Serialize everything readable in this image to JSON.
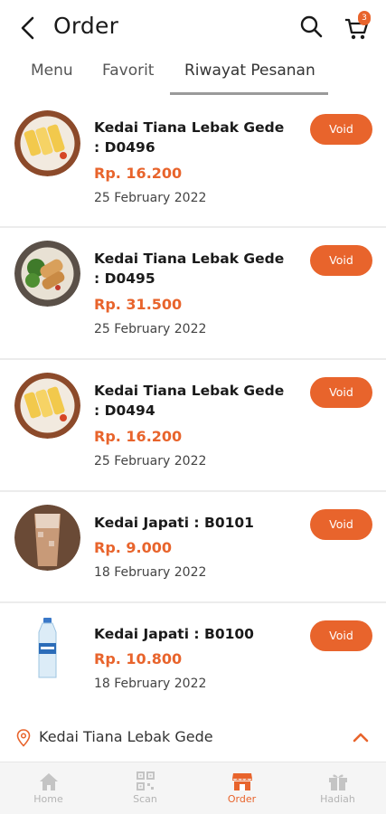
{
  "header": {
    "title": "Order",
    "cart_count": "3"
  },
  "tabs": [
    {
      "label": "Menu",
      "active": false
    },
    {
      "label": "Favorit",
      "active": false
    },
    {
      "label": "Riwayat Pesanan",
      "active": true
    }
  ],
  "orders": [
    {
      "name": "Kedai Tiana Lebak Gede : D0496",
      "price": "Rp. 16.200",
      "date": "25 February 2022",
      "action": "Void",
      "image": "omelette-roll"
    },
    {
      "name": "Kedai Tiana Lebak Gede : D0495",
      "price": "Rp. 31.500",
      "date": "25 February 2022",
      "action": "Void",
      "image": "wrap-with-salad"
    },
    {
      "name": "Kedai Tiana Lebak Gede : D0494",
      "price": "Rp. 16.200",
      "date": "25 February 2022",
      "action": "Void",
      "image": "omelette-roll"
    },
    {
      "name": "Kedai Japati : B0101",
      "price": "Rp. 9.000",
      "date": "18 February 2022",
      "action": "Void",
      "image": "iced-milk-tea"
    },
    {
      "name": "Kedai Japati : B0100",
      "price": "Rp. 10.800",
      "date": "18 February 2022",
      "action": "Void",
      "image": "water-bottle"
    }
  ],
  "location": {
    "name": "Kedai Tiana Lebak Gede"
  },
  "bottom_nav": [
    {
      "label": "Home",
      "icon": "home-icon",
      "active": false
    },
    {
      "label": "Scan",
      "icon": "qr-icon",
      "active": false
    },
    {
      "label": "Order",
      "icon": "store-icon",
      "active": true
    },
    {
      "label": "Hadiah",
      "icon": "gift-icon",
      "active": false
    }
  ],
  "colors": {
    "accent": "#e8642c",
    "inactive_nav": "#b4b4b4"
  }
}
